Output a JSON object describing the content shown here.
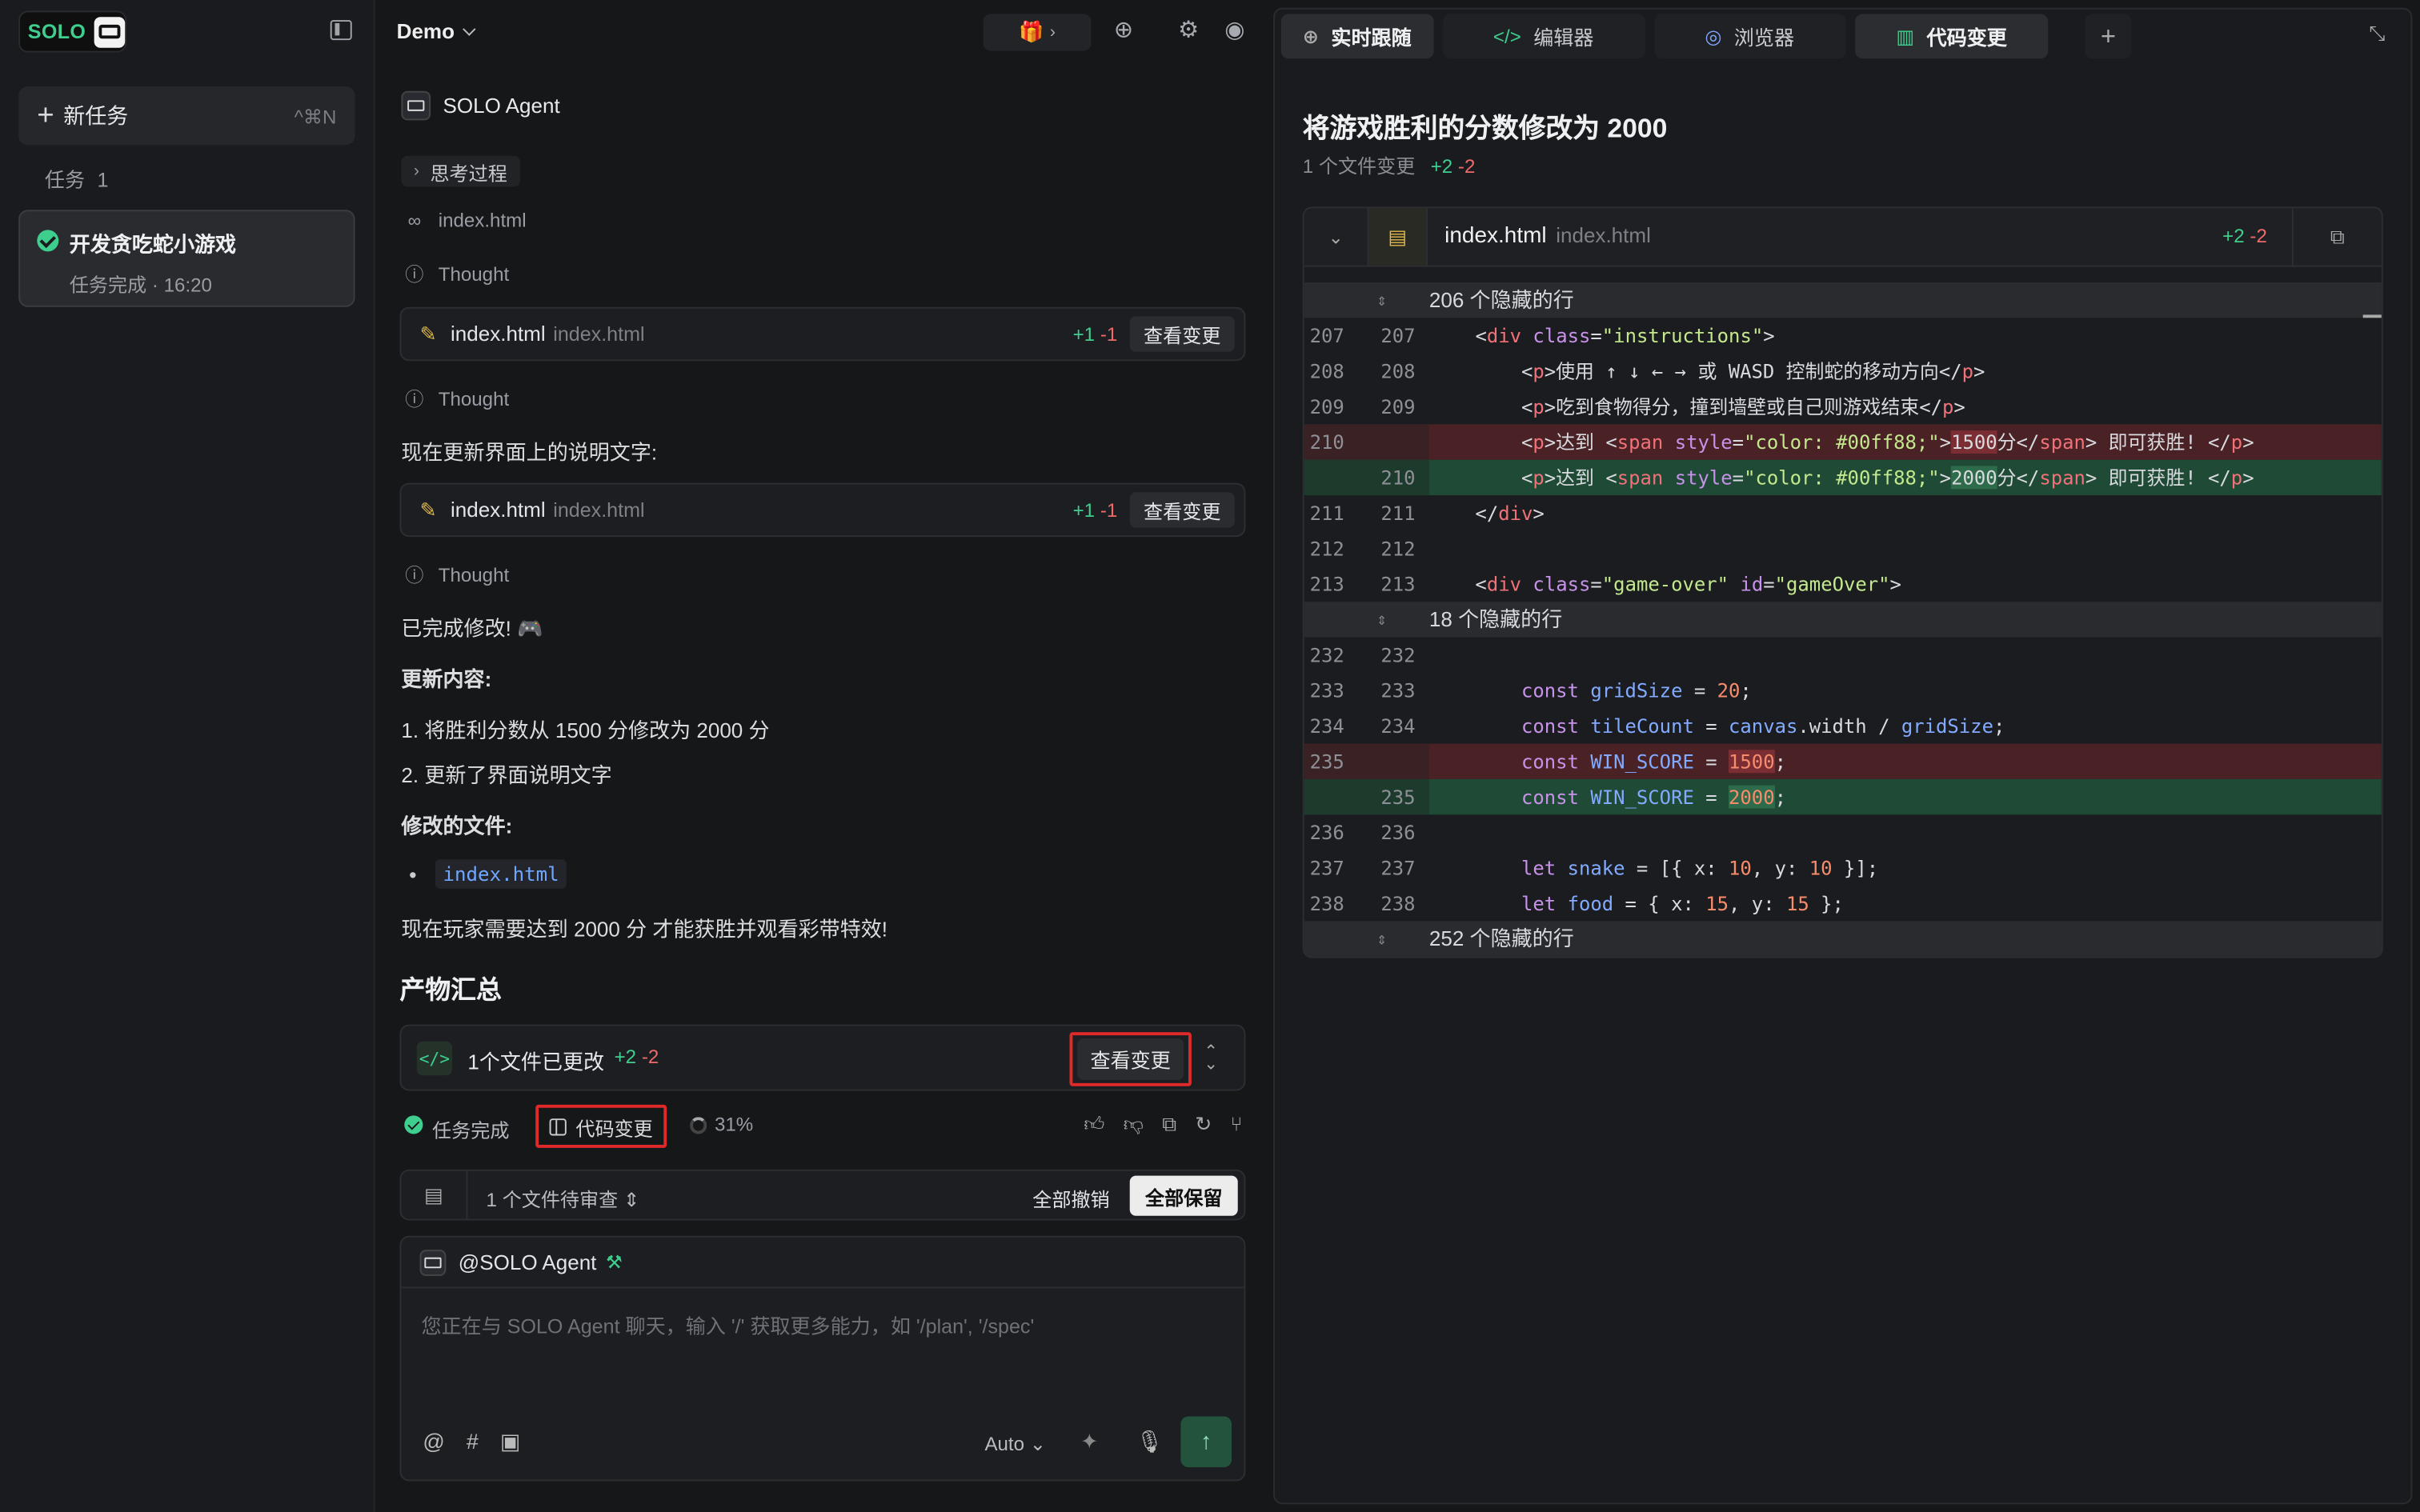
{
  "sidebar": {
    "logo_text": "SOLO",
    "new_task_label": "新任务",
    "new_task_shortcut": "^⌘N",
    "tasks_label": "任务",
    "tasks_count": "1",
    "task": {
      "title": "开发贪吃蛇小游戏",
      "subtitle": "任务完成 · 16:20"
    }
  },
  "chat": {
    "project": "Demo",
    "agent_name": "SOLO Agent",
    "thinking_label": "思考过程",
    "read_file": "index.html",
    "thought_label": "Thought",
    "edits": [
      {
        "file": "index.html",
        "path": "index.html",
        "add": "+1",
        "del": "-1",
        "button": "查看变更"
      },
      {
        "file": "index.html",
        "path": "index.html",
        "add": "+1",
        "del": "-1",
        "button": "查看变更"
      }
    ],
    "update_text": "现在更新界面上的说明文字:",
    "done_text": "已完成修改! 🎮",
    "update_content_label": "更新内容:",
    "items": [
      "1. 将胜利分数从 1500 分修改为 2000 分",
      "2. 更新了界面说明文字"
    ],
    "modified_files_label": "修改的文件:",
    "modified_file": "index.html",
    "final_text": "现在玩家需要达到 2000 分 才能获胜并观看彩带特效!",
    "summary_title": "产物汇总",
    "summary": {
      "label": "1个文件已更改",
      "add": "+2",
      "del": "-2",
      "button": "查看变更"
    },
    "status": {
      "done": "任务完成",
      "code_changes": "代码变更",
      "progress": "31%"
    },
    "review": {
      "label": "1 个文件待审查",
      "undo_all": "全部撤销",
      "keep_all": "全部保留"
    },
    "input": {
      "mention": "@SOLO Agent",
      "placeholder": "您正在与 SOLO Agent 聊天，输入 '/' 获取更多能力，如 '/plan', '/spec'",
      "mode": "Auto"
    }
  },
  "tabs": [
    {
      "label": "实时跟随",
      "icon": "crosshair-icon",
      "active": true
    },
    {
      "label": "编辑器",
      "icon": "code-icon",
      "active": false
    },
    {
      "label": "浏览器",
      "icon": "compass-icon",
      "active": false
    },
    {
      "label": "代码变更",
      "icon": "diff-icon",
      "active": true
    }
  ],
  "diff": {
    "title": "将游戏胜利的分数修改为 2000",
    "files_changed": "1 个文件变更",
    "add": "+2",
    "del": "-2",
    "file": "index.html",
    "path": "index.html",
    "hidden1": "206 个隐藏的行",
    "hidden2": "18 个隐藏的行",
    "hidden3": "252 个隐藏的行"
  },
  "colors": {
    "accent": "#3ecf8e",
    "delete": "#f06a6a",
    "highlight_border": "#e02a2a"
  }
}
